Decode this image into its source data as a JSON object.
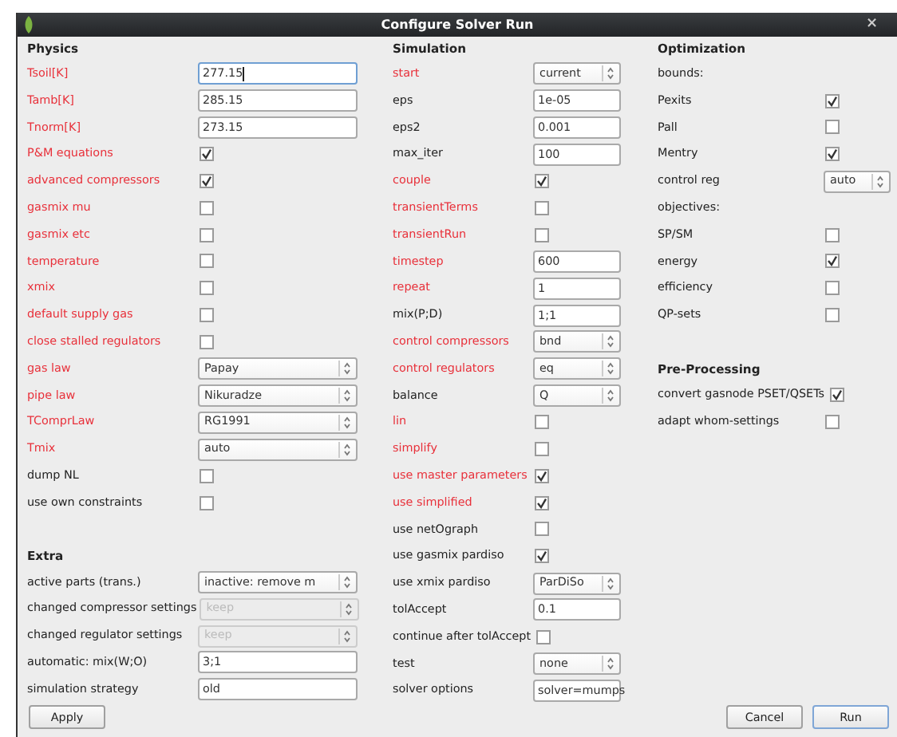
{
  "window": {
    "title": "Configure Solver Run",
    "close": "×"
  },
  "columns": [
    {
      "sections": [
        {
          "title": "Physics",
          "rows": [
            {
              "kind": "text",
              "label": "Tsoil[K]",
              "highlight": true,
              "value": "277.15",
              "focused": true
            },
            {
              "kind": "text",
              "label": "Tamb[K]",
              "highlight": true,
              "value": "285.15",
              "focused": false
            },
            {
              "kind": "text",
              "label": "Tnorm[K]",
              "highlight": true,
              "value": "273.15",
              "focused": false
            },
            {
              "kind": "check",
              "label": "P&M equations",
              "highlight": true,
              "checked": true
            },
            {
              "kind": "check",
              "label": "advanced compressors",
              "highlight": true,
              "checked": true
            },
            {
              "kind": "check",
              "label": "gasmix mu",
              "highlight": true,
              "checked": false
            },
            {
              "kind": "check",
              "label": "gasmix etc",
              "highlight": true,
              "checked": false
            },
            {
              "kind": "check",
              "label": "temperature",
              "highlight": true,
              "checked": false
            },
            {
              "kind": "check",
              "label": "xmix",
              "highlight": true,
              "checked": false
            },
            {
              "kind": "check",
              "label": "default supply gas",
              "highlight": true,
              "checked": false
            },
            {
              "kind": "check",
              "label": "close stalled regulators",
              "highlight": true,
              "checked": false
            },
            {
              "kind": "select",
              "label": "gas law",
              "highlight": true,
              "value": "Papay",
              "disabled": false
            },
            {
              "kind": "select",
              "label": "pipe law",
              "highlight": true,
              "value": "Nikuradze",
              "disabled": false
            },
            {
              "kind": "select",
              "label": "TComprLaw",
              "highlight": true,
              "value": "RG1991",
              "disabled": false
            },
            {
              "kind": "select",
              "label": "Tmix",
              "highlight": true,
              "value": "auto",
              "disabled": false
            },
            {
              "kind": "check",
              "label": "dump NL",
              "highlight": false,
              "checked": false
            },
            {
              "kind": "check",
              "label": "use own constraints",
              "highlight": false,
              "checked": false
            }
          ]
        },
        {
          "title": "Extra",
          "rows": [
            {
              "kind": "select",
              "label": "active parts (trans.)",
              "highlight": false,
              "value": "inactive: remove m",
              "disabled": false
            },
            {
              "kind": "select",
              "label": "changed compressor settings",
              "highlight": false,
              "value": "keep",
              "disabled": true
            },
            {
              "kind": "select",
              "label": "changed regulator settings",
              "highlight": false,
              "value": "keep",
              "disabled": true
            },
            {
              "kind": "text",
              "label": "automatic: mix(W;O)",
              "highlight": false,
              "value": "3;1",
              "focused": false
            },
            {
              "kind": "text",
              "label": "simulation strategy",
              "highlight": false,
              "value": "old",
              "focused": false
            }
          ]
        }
      ]
    },
    {
      "sections": [
        {
          "title": "Simulation",
          "rows": [
            {
              "kind": "select",
              "label": "start",
              "highlight": true,
              "value": "current",
              "disabled": false
            },
            {
              "kind": "text",
              "label": "eps",
              "highlight": false,
              "value": "1e-05",
              "focused": false
            },
            {
              "kind": "text",
              "label": "eps2",
              "highlight": false,
              "value": "0.001",
              "focused": false
            },
            {
              "kind": "text",
              "label": "max_iter",
              "highlight": false,
              "value": "100",
              "focused": false
            },
            {
              "kind": "check",
              "label": "couple",
              "highlight": true,
              "checked": true
            },
            {
              "kind": "check",
              "label": "transientTerms",
              "highlight": true,
              "checked": false
            },
            {
              "kind": "check",
              "label": "transientRun",
              "highlight": true,
              "checked": false
            },
            {
              "kind": "text",
              "label": "timestep",
              "highlight": true,
              "value": "600",
              "focused": false
            },
            {
              "kind": "text",
              "label": "repeat",
              "highlight": true,
              "value": "1",
              "focused": false
            },
            {
              "kind": "text",
              "label": "mix(P;D)",
              "highlight": false,
              "value": "1;1",
              "focused": false
            },
            {
              "kind": "select",
              "label": "control compressors",
              "highlight": true,
              "value": "bnd",
              "disabled": false
            },
            {
              "kind": "select",
              "label": "control regulators",
              "highlight": true,
              "value": "eq",
              "disabled": false
            },
            {
              "kind": "select",
              "label": "balance",
              "highlight": false,
              "value": "Q",
              "disabled": false
            },
            {
              "kind": "check",
              "label": "lin",
              "highlight": true,
              "checked": false
            },
            {
              "kind": "check",
              "label": "simplify",
              "highlight": true,
              "checked": false
            },
            {
              "kind": "check",
              "label": "use master parameters",
              "highlight": true,
              "checked": true
            },
            {
              "kind": "check",
              "label": "use simplified",
              "highlight": true,
              "checked": true
            },
            {
              "kind": "check",
              "label": "use netOgraph",
              "highlight": false,
              "checked": false
            },
            {
              "kind": "check",
              "label": "use gasmix pardiso",
              "highlight": false,
              "checked": true
            },
            {
              "kind": "select",
              "label": "use xmix pardiso",
              "highlight": false,
              "value": "ParDiSo",
              "disabled": false
            },
            {
              "kind": "text",
              "label": "tolAccept",
              "highlight": false,
              "value": "0.1",
              "focused": false
            },
            {
              "kind": "check",
              "label": "continue after tolAccept",
              "highlight": false,
              "checked": false
            },
            {
              "kind": "select",
              "label": "test",
              "highlight": false,
              "value": "none",
              "disabled": false
            },
            {
              "kind": "text",
              "label": "solver options",
              "highlight": false,
              "value": "solver=mumps",
              "focused": false
            }
          ]
        }
      ]
    },
    {
      "sections": [
        {
          "title": "Optimization",
          "rows": [
            {
              "kind": "note",
              "label": "bounds:",
              "highlight": false
            },
            {
              "kind": "check",
              "label": "Pexits",
              "highlight": false,
              "checked": true
            },
            {
              "kind": "check",
              "label": "Pall",
              "highlight": false,
              "checked": false
            },
            {
              "kind": "check",
              "label": "Mentry",
              "highlight": false,
              "checked": true
            },
            {
              "kind": "select",
              "label": "control reg",
              "highlight": false,
              "value": "auto",
              "disabled": false
            },
            {
              "kind": "note",
              "label": "objectives:",
              "highlight": false
            },
            {
              "kind": "check",
              "label": "SP/SM",
              "highlight": false,
              "checked": false
            },
            {
              "kind": "check",
              "label": "energy",
              "highlight": false,
              "checked": true
            },
            {
              "kind": "check",
              "label": "efficiency",
              "highlight": false,
              "checked": false
            },
            {
              "kind": "check",
              "label": "QP-sets",
              "highlight": false,
              "checked": false
            }
          ]
        },
        {
          "title": "Pre-Processing",
          "rows": [
            {
              "kind": "check",
              "label": "convert gasnode PSET/QSETs",
              "highlight": false,
              "checked": true
            },
            {
              "kind": "check",
              "label": "adapt whom-settings",
              "highlight": false,
              "checked": false
            }
          ]
        }
      ]
    }
  ],
  "buttons": [
    {
      "label": "Apply",
      "default": false
    },
    {
      "label": "Cancel",
      "default": false
    },
    {
      "label": "Run",
      "default": true
    }
  ]
}
